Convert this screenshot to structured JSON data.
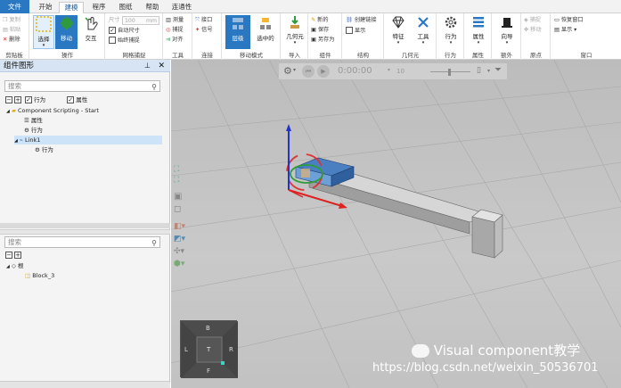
{
  "menu_tabs": [
    "文件",
    "开始",
    "建模",
    "程序",
    "图纸",
    "帮助",
    "连通性"
  ],
  "active_tab": "建模",
  "ribbon": {
    "clipboard": {
      "copy": "复制",
      "paste": "粘贴",
      "delete": "删除",
      "label": "剪贴板"
    },
    "manipulate": {
      "select": "选择",
      "move": "移动",
      "interact": "交互",
      "label": "操作"
    },
    "grid_snap": {
      "size_label": "尺寸",
      "size_value": "100",
      "unit": "mm",
      "auto_size": "自动尺寸",
      "always_snap": "始终捕捉",
      "label": "网格捕捉"
    },
    "tools": {
      "measure": "测量",
      "snap": "捕捉",
      "align": "对齐",
      "label": "工具"
    },
    "connect": {
      "interface": "接口",
      "signal": "信号",
      "label": "连接"
    },
    "move_mode": {
      "level": "层级",
      "selected": "选中的",
      "label": "移动模式"
    },
    "import": {
      "geometry": "几何元",
      "label": "导入"
    },
    "component": {
      "new": "新的",
      "save": "保存",
      "save_as": "另存为",
      "label": "组件"
    },
    "structure": {
      "create_link": "创建链接",
      "show": "显示",
      "label": "结构"
    },
    "geometry": {
      "feature": "特征",
      "tools": "工具",
      "label": "几何元"
    },
    "behavior": {
      "behavior": "行为",
      "label": "行为"
    },
    "properties": {
      "properties": "属性",
      "label": "属性"
    },
    "extra": {
      "wizard": "向导",
      "label": "额外"
    },
    "origin": {
      "snap": "捕捉",
      "move": "移动",
      "label": "原点"
    },
    "window": {
      "restore": "恢复窗口",
      "show": "显示",
      "label": "窗口"
    }
  },
  "component_panel": {
    "title": "组件图形",
    "search_placeholder": "搜索",
    "filters": {
      "behavior": "行为",
      "properties": "属性"
    },
    "tree": [
      {
        "label": "Component Scripting - Start"
      },
      {
        "label": "属性"
      },
      {
        "label": "行为"
      },
      {
        "label": "Link1"
      },
      {
        "label": "行为"
      }
    ]
  },
  "geometry_panel": {
    "search_placeholder": "搜索",
    "tree": [
      {
        "label": "根"
      },
      {
        "label": "Block_3"
      }
    ]
  },
  "playback": {
    "time": "0:00:00",
    "speed": "10"
  },
  "navcube": {
    "top": "B",
    "left": "L",
    "center": "T",
    "right": "R",
    "bottom": "F"
  },
  "watermark": {
    "brand": "Visual component教学",
    "url": "https://blog.csdn.net/weixin_50536701"
  }
}
